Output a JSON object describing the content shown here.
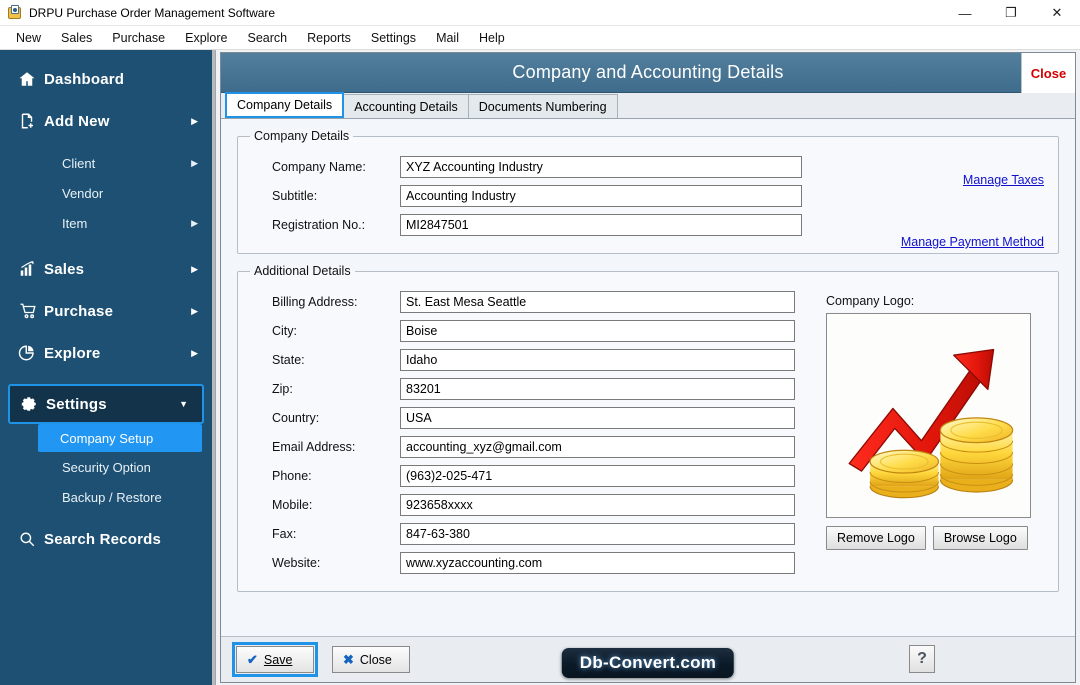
{
  "window": {
    "title": "DRPU Purchase Order Management Software",
    "icon": "app-icon",
    "controls": {
      "minimize": "—",
      "restore": "❐",
      "close": "✕"
    }
  },
  "menubar": {
    "items": [
      "New",
      "Sales",
      "Purchase",
      "Explore",
      "Search",
      "Reports",
      "Settings",
      "Mail",
      "Help"
    ]
  },
  "sidebar": {
    "items": [
      {
        "label": "Dashboard",
        "icon": "home-icon",
        "chevron": "",
        "level": "top"
      },
      {
        "label": "Add New",
        "icon": "document-plus-icon",
        "chevron": "▶",
        "level": "top"
      },
      {
        "label": "Client",
        "icon": "",
        "chevron": "▶",
        "level": "sub"
      },
      {
        "label": "Vendor",
        "icon": "",
        "chevron": "",
        "level": "sub"
      },
      {
        "label": "Item",
        "icon": "",
        "chevron": "▶",
        "level": "sub"
      },
      {
        "label": "Sales",
        "icon": "bar-chart-icon",
        "chevron": "▶",
        "level": "top"
      },
      {
        "label": "Purchase",
        "icon": "shopping-cart-icon",
        "chevron": "▶",
        "level": "top"
      },
      {
        "label": "Explore",
        "icon": "pie-chart-icon",
        "chevron": "▶",
        "level": "top"
      },
      {
        "label": "Settings",
        "icon": "gear-icon",
        "chevron": "▼",
        "level": "top",
        "selected": true
      },
      {
        "label": "Company Setup",
        "icon": "",
        "chevron": "",
        "level": "sub",
        "active": true
      },
      {
        "label": "Security Option",
        "icon": "",
        "chevron": "",
        "level": "sub"
      },
      {
        "label": "Backup / Restore",
        "icon": "",
        "chevron": "",
        "level": "sub"
      },
      {
        "label": "Search Records",
        "icon": "search-icon",
        "chevron": "",
        "level": "top"
      }
    ]
  },
  "form": {
    "header_title": "Company and Accounting Details",
    "header_close": "Close",
    "tabs": [
      {
        "label": "Company Details",
        "active": true
      },
      {
        "label": "Accounting Details",
        "active": false
      },
      {
        "label": "Documents Numbering",
        "active": false
      }
    ]
  },
  "company_details": {
    "legend": "Company Details",
    "fields": [
      {
        "label": "Company Name:",
        "value": "XYZ Accounting Industry"
      },
      {
        "label": "Subtitle:",
        "value": "Accounting Industry"
      },
      {
        "label": "Registration No.:",
        "value": "MI2847501"
      }
    ],
    "links": [
      {
        "label": "Manage Taxes"
      },
      {
        "label": "Manage Payment Method"
      }
    ]
  },
  "additional_details": {
    "legend": "Additional Details",
    "fields": [
      {
        "label": "Billing Address:",
        "value": "St. East Mesa Seattle"
      },
      {
        "label": "City:",
        "value": "Boise"
      },
      {
        "label": "State:",
        "value": "Idaho"
      },
      {
        "label": "Zip:",
        "value": "83201"
      },
      {
        "label": "Country:",
        "value": "USA"
      },
      {
        "label": "Email Address:",
        "value": "accounting_xyz@gmail.com"
      },
      {
        "label": "Phone:",
        "value": "(963)2-025-471"
      },
      {
        "label": "Mobile:",
        "value": "923658xxxx"
      },
      {
        "label": "Fax:",
        "value": "847-63-380"
      },
      {
        "label": "Website:",
        "value": "www.xyzaccounting.com"
      }
    ],
    "logo": {
      "caption": "Company Logo:",
      "image_name": "growth-chart-coins-logo",
      "remove_label": "Remove Logo",
      "browse_label": "Browse Logo"
    }
  },
  "footer": {
    "save_label": "Save",
    "close_label": "Close",
    "help_label": "?",
    "watermark": "Db-Convert.com"
  },
  "colors": {
    "sidebar_bg": "#1d5072",
    "header_bg": "#4a7591",
    "accent_blue": "#1f93e8",
    "active_item": "#2196f3",
    "link_blue": "#1111cc",
    "close_red": "#d40000"
  }
}
